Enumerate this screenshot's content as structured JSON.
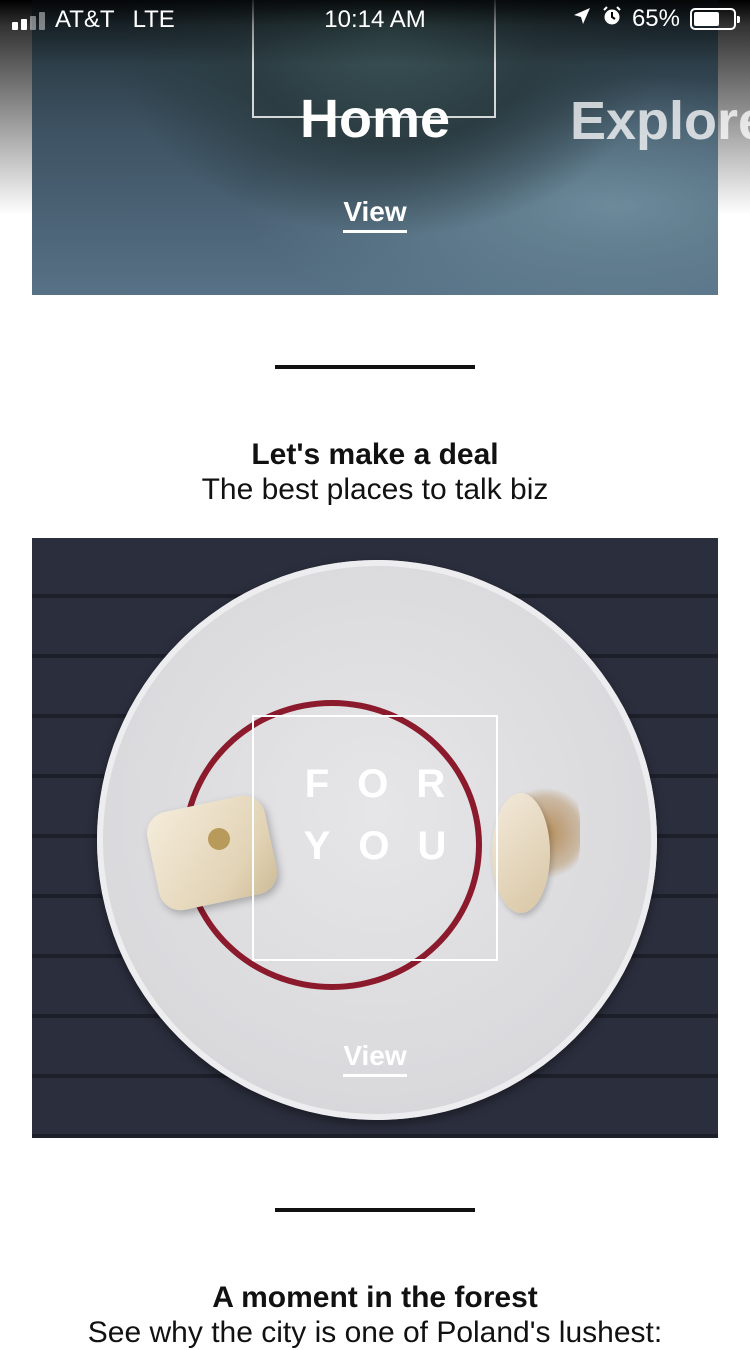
{
  "status_bar": {
    "carrier": "AT&T",
    "network": "LTE",
    "time": "10:14 AM",
    "battery": "65%",
    "battery_level": 0.65
  },
  "hero": {
    "title": "Home",
    "next_title": "Explore",
    "view_label": "View"
  },
  "sections": [
    {
      "title": "Let's make a deal",
      "subtitle": "The best places to talk biz",
      "card_line1": "FOR",
      "card_line2": "YOU",
      "view_label": "View"
    },
    {
      "title": "A moment in the forest",
      "subtitle": "See why the city is one of Poland's lushest:"
    }
  ]
}
